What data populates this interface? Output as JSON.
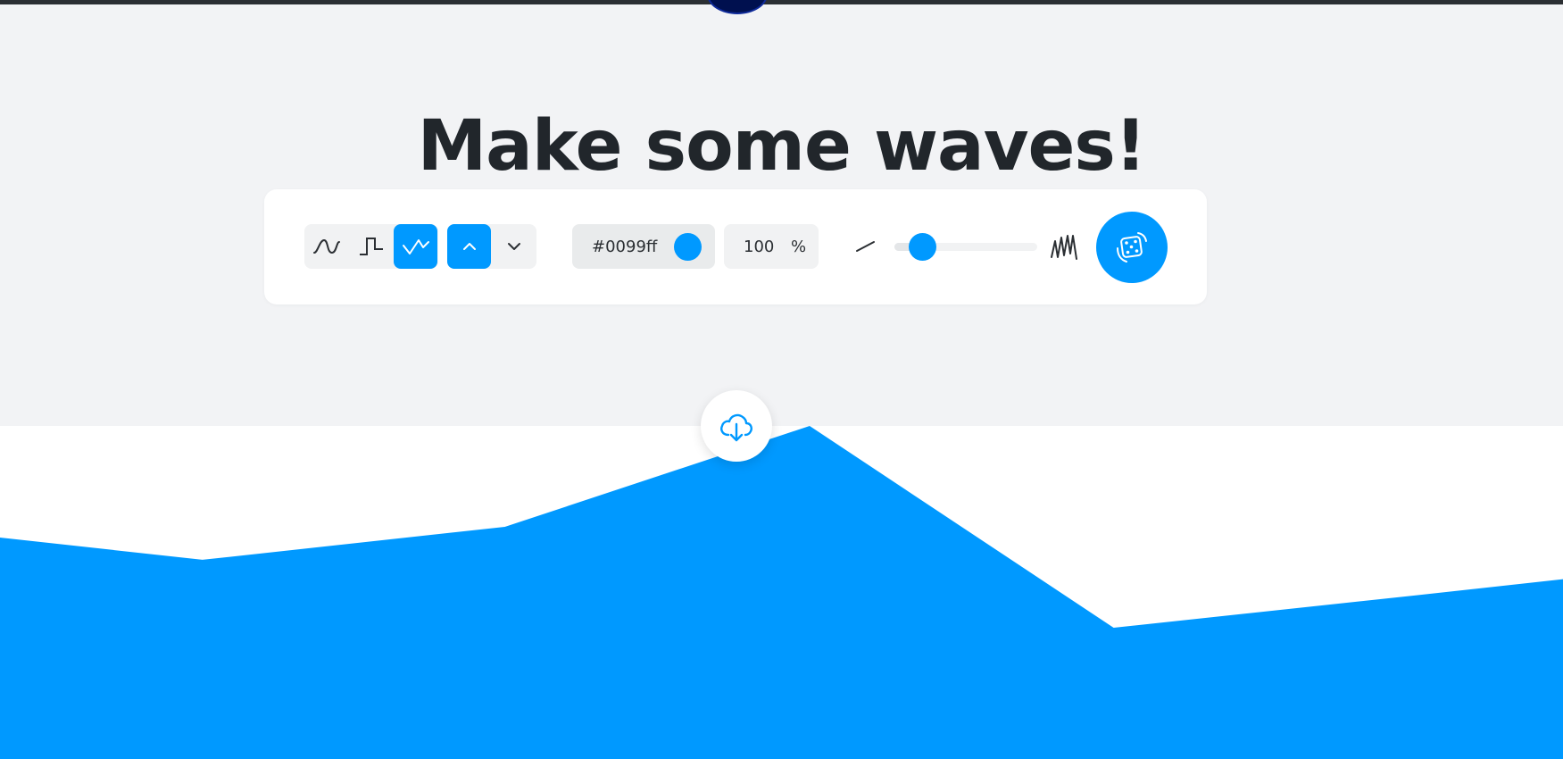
{
  "page": {
    "title": "Make some waves!"
  },
  "toolbar": {
    "wave_types": [
      {
        "id": "smooth",
        "icon": "sine-wave-icon",
        "active": false
      },
      {
        "id": "step",
        "icon": "step-wave-icon",
        "active": false
      },
      {
        "id": "peak",
        "icon": "peak-wave-icon",
        "active": true
      }
    ],
    "directions": [
      {
        "id": "up",
        "icon": "chevron-up-icon",
        "active": true
      },
      {
        "id": "down",
        "icon": "chevron-down-icon",
        "active": false
      }
    ],
    "color": {
      "value": "#0099ff",
      "swatch": "#0099ff"
    },
    "opacity": {
      "value": "100",
      "unit": "%"
    },
    "complexity": {
      "low_icon": "low-complexity-icon",
      "high_icon": "high-complexity-icon",
      "level": 0.1
    },
    "randomize": {
      "icon": "dice-icon"
    }
  },
  "download": {
    "icon": "cloud-download-icon"
  },
  "wave": {
    "fill": "#0099ff",
    "points": [
      [
        0,
        0.335
      ],
      [
        0.1295,
        0.402
      ],
      [
        0.323,
        0.303
      ],
      [
        0.518,
        0.0
      ],
      [
        0.7125,
        0.606
      ],
      [
        0.907,
        0.508
      ],
      [
        1.0,
        0.46
      ]
    ]
  },
  "colors": {
    "accent": "#0099ff",
    "background": "#f2f3f5",
    "text": "#21262b"
  }
}
